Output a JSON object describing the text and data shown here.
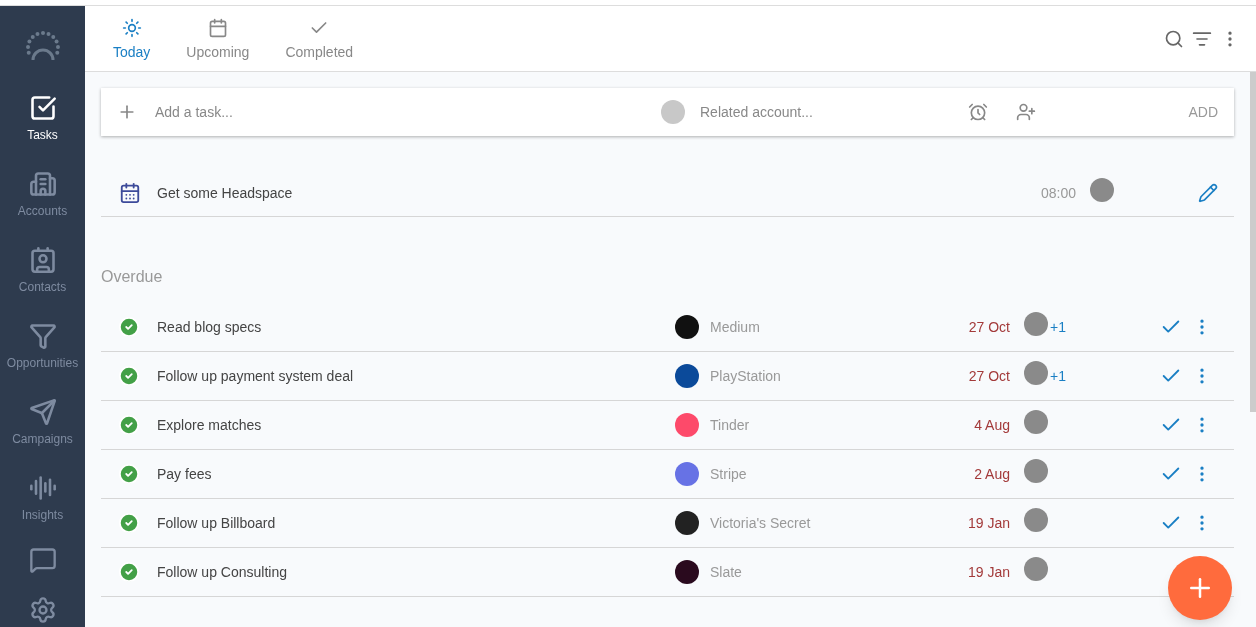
{
  "sidebar": {
    "items": [
      {
        "label": "Tasks",
        "selected": true
      },
      {
        "label": "Accounts",
        "selected": false
      },
      {
        "label": "Contacts",
        "selected": false
      },
      {
        "label": "Opportunities",
        "selected": false
      },
      {
        "label": "Campaigns",
        "selected": false
      },
      {
        "label": "Insights",
        "selected": false
      }
    ]
  },
  "tabs": [
    {
      "label": "Today",
      "selected": true
    },
    {
      "label": "Upcoming",
      "selected": false
    },
    {
      "label": "Completed",
      "selected": false
    }
  ],
  "add_task": {
    "placeholder": "Add a task...",
    "account_placeholder": "Related account...",
    "button": "ADD"
  },
  "today_tasks": [
    {
      "title": "Get some Headspace",
      "time": "08:00"
    }
  ],
  "overdue": {
    "heading": "Overdue",
    "tasks": [
      {
        "title": "Read blog specs",
        "account": "Medium",
        "color": "#111111",
        "date": "27 Oct",
        "extra": "+1",
        "done": true
      },
      {
        "title": "Follow up payment system deal",
        "account": "PlayStation",
        "color": "#0b4a9a",
        "date": "27 Oct",
        "extra": "+1",
        "done": true
      },
      {
        "title": "Explore matches",
        "account": "Tinder",
        "color": "#fd4a6a",
        "date": "4 Aug",
        "done": true
      },
      {
        "title": "Pay fees",
        "account": "Stripe",
        "color": "#6772e5",
        "date": "2 Aug",
        "done": true
      },
      {
        "title": "Follow up Billboard",
        "account": "Victoria's Secret",
        "color": "#222222",
        "date": "19 Jan",
        "done": true
      },
      {
        "title": "Follow up Consulting",
        "account": "Slate",
        "color": "#2a0a1e",
        "date": "19 Jan",
        "done": true
      }
    ]
  }
}
